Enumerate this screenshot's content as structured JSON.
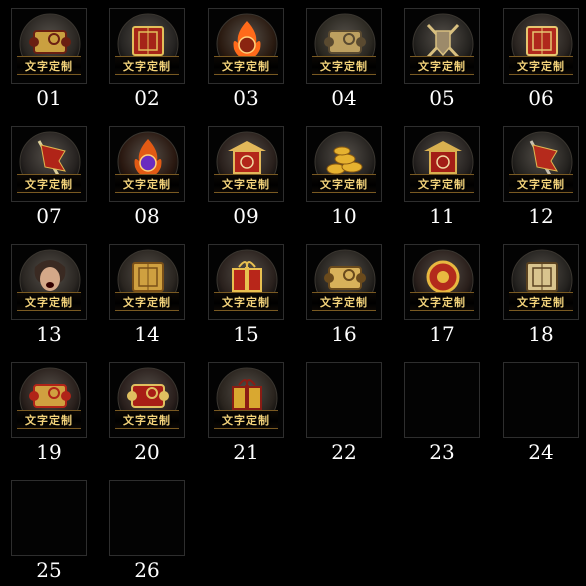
{
  "label_text": "文字定制",
  "slots": [
    {
      "num": "01",
      "icon": "golden-scroll-chest-icon",
      "filled": true
    },
    {
      "num": "02",
      "icon": "red-book-feather-icon",
      "filled": true
    },
    {
      "num": "03",
      "icon": "fire-ring-gate-icon",
      "filled": true
    },
    {
      "num": "04",
      "icon": "map-magnifier-icon",
      "filled": true
    },
    {
      "num": "05",
      "icon": "crossed-swords-crest-icon",
      "filled": true
    },
    {
      "num": "06",
      "icon": "red-rune-book-icon",
      "filled": true
    },
    {
      "num": "07",
      "icon": "red-flag-sword-icon",
      "filled": true
    },
    {
      "num": "08",
      "icon": "flaming-gem-crest-icon",
      "filled": true
    },
    {
      "num": "09",
      "icon": "red-temple-icon",
      "filled": true
    },
    {
      "num": "10",
      "icon": "gold-coins-icon",
      "filled": true
    },
    {
      "num": "11",
      "icon": "hanging-plaque-icon",
      "filled": true
    },
    {
      "num": "12",
      "icon": "red-banner-axe-icon",
      "filled": true
    },
    {
      "num": "13",
      "icon": "shouting-warrior-icon",
      "filled": true
    },
    {
      "num": "14",
      "icon": "golden-tablet-icon",
      "filled": true
    },
    {
      "num": "15",
      "icon": "red-gift-box-icon",
      "filled": true
    },
    {
      "num": "16",
      "icon": "golden-open-scroll-icon",
      "filled": true
    },
    {
      "num": "17",
      "icon": "red-gold-shield-icon",
      "filled": true
    },
    {
      "num": "18",
      "icon": "open-rune-book-icon",
      "filled": true
    },
    {
      "num": "19",
      "icon": "sealed-scroll-icon",
      "filled": true
    },
    {
      "num": "20",
      "icon": "red-seal-document-icon",
      "filled": true
    },
    {
      "num": "21",
      "icon": "golden-treasure-chest-icon",
      "filled": true
    },
    {
      "num": "22",
      "icon": "",
      "filled": false
    },
    {
      "num": "23",
      "icon": "",
      "filled": false
    },
    {
      "num": "24",
      "icon": "",
      "filled": false
    },
    {
      "num": "25",
      "icon": "",
      "filled": false
    },
    {
      "num": "26",
      "icon": "",
      "filled": false
    }
  ]
}
